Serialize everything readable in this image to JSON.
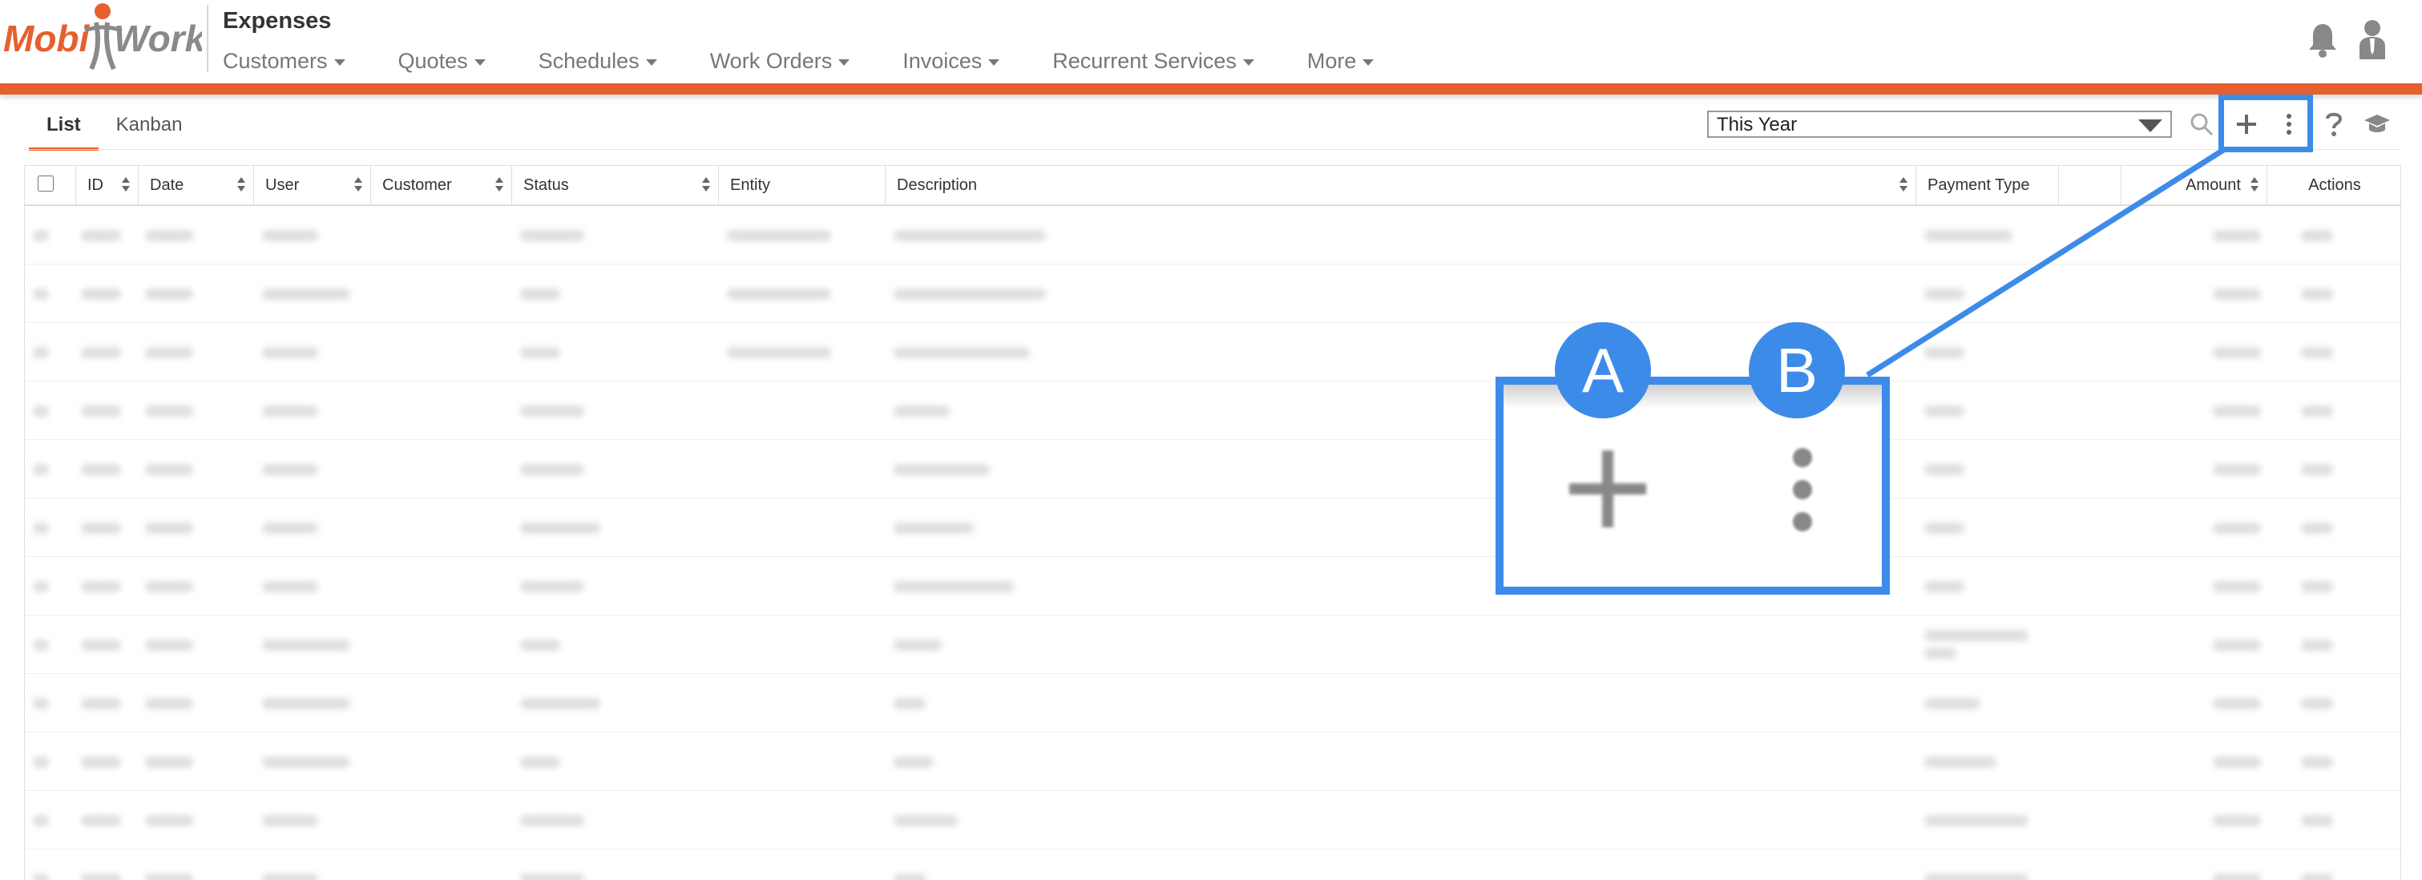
{
  "header": {
    "logo_text_left": "Mobi",
    "logo_text_right": "Work",
    "page_title": "Expenses",
    "nav": [
      {
        "label": "Customers"
      },
      {
        "label": "Quotes"
      },
      {
        "label": "Schedules"
      },
      {
        "label": "Work Orders"
      },
      {
        "label": "Invoices"
      },
      {
        "label": "Recurrent Services"
      },
      {
        "label": "More"
      }
    ],
    "accent_color": "#e4602f"
  },
  "toolbar": {
    "tabs": [
      {
        "label": "List",
        "active": true
      },
      {
        "label": "Kanban",
        "active": false
      }
    ],
    "period_select": "This Year",
    "icons": [
      "search-icon",
      "add-icon",
      "more-vertical-icon",
      "help-icon",
      "graduation-cap-icon"
    ]
  },
  "table": {
    "columns": [
      {
        "label": ""
      },
      {
        "label": "ID"
      },
      {
        "label": "Date"
      },
      {
        "label": "User"
      },
      {
        "label": "Customer"
      },
      {
        "label": "Status"
      },
      {
        "label": "Entity"
      },
      {
        "label": "Description"
      },
      {
        "label": "Payment Type"
      },
      {
        "label": ""
      },
      {
        "label": "Amount"
      },
      {
        "label": "Actions"
      }
    ]
  },
  "callout": {
    "badge_a": "A",
    "badge_b": "B",
    "highlight_color": "#3d8be8"
  }
}
